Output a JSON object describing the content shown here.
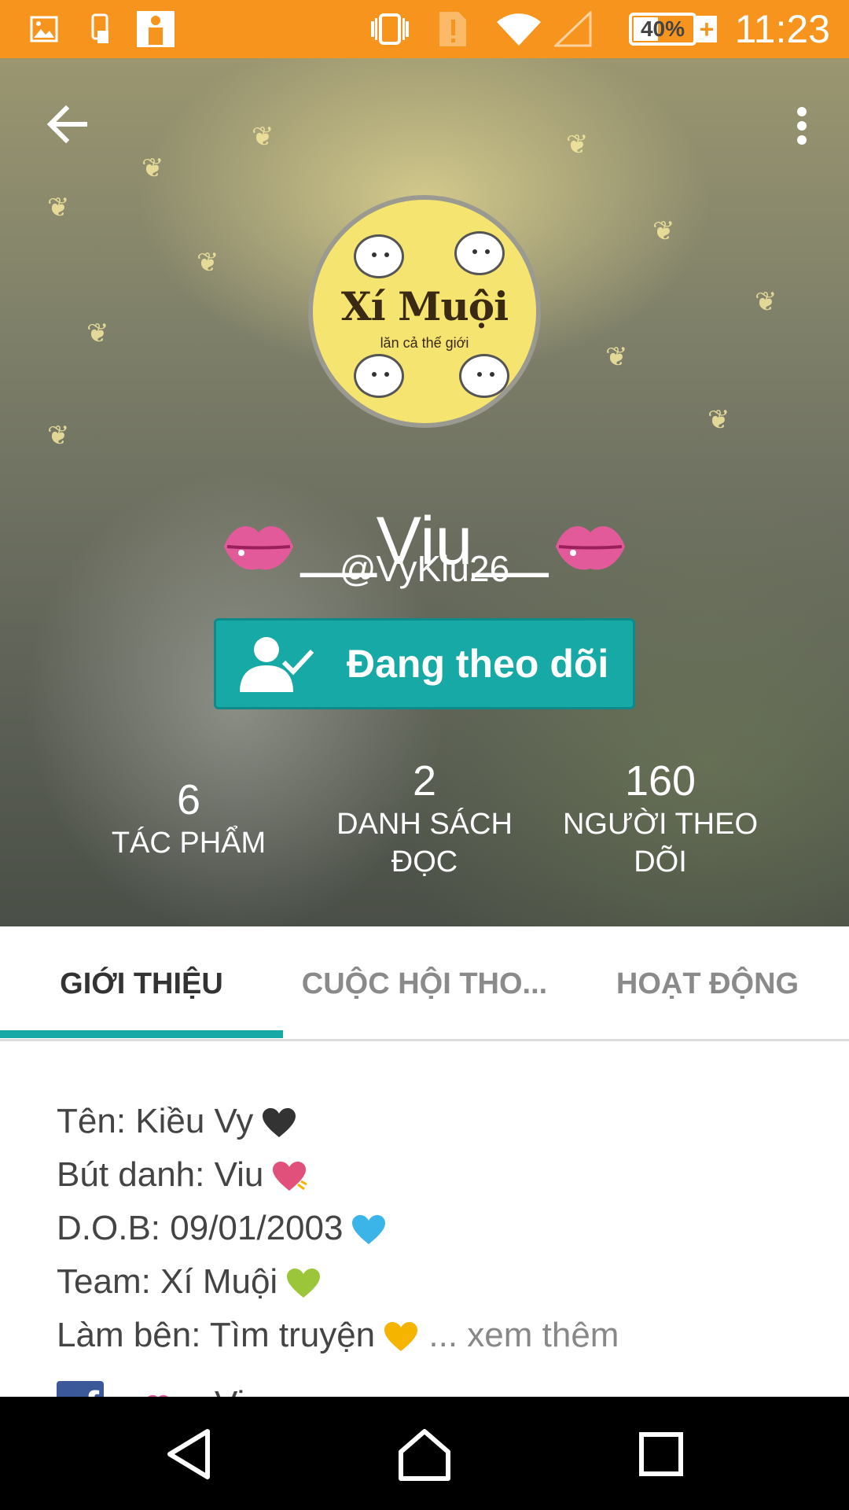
{
  "status_bar": {
    "time": "11:23",
    "battery": "40%",
    "battery_level": 0.4,
    "icons": [
      "image-icon",
      "phone-transfer-icon",
      "person-card-icon",
      "vibrate-icon",
      "alert-sim-icon",
      "wifi-icon",
      "signal-icon",
      "battery-icon",
      "charging-icon"
    ]
  },
  "header": {
    "back_icon": "arrow-left-icon",
    "more_icon": "more-vertical-icon"
  },
  "profile": {
    "avatar_title": "Xí Muội",
    "avatar_subtitle": "lăn cả thế giới",
    "display_name": "__Viu__",
    "handle": "@VyKiu26",
    "follow_button": "Đang theo dõi"
  },
  "stats": [
    {
      "value": "6",
      "label": "TÁC PHẨM"
    },
    {
      "value": "2",
      "label": "DANH SÁCH ĐỌC"
    },
    {
      "value": "160",
      "label": "NGƯỜI THEO DÕI"
    }
  ],
  "tabs": [
    {
      "label": "GIỚI THIỆU",
      "active": true
    },
    {
      "label": "CUỘC HỘI THO...",
      "active": false
    },
    {
      "label": "HOẠT ĐỘNG",
      "active": false
    }
  ],
  "about": {
    "lines": [
      {
        "text": "Tên: Kiều Vy",
        "heart_color": "#333333"
      },
      {
        "text": "Bút danh: Viu",
        "heart_color": "#e0507a"
      },
      {
        "text": "D.O.B: 09/01/2003",
        "heart_color": "#3bb5e8"
      },
      {
        "text": "Team: Xí Muội",
        "heart_color": "#9cc63a"
      },
      {
        "text": "Làm bên: Tìm truyện",
        "heart_color": "#f4b400"
      }
    ],
    "more": "... xem thêm",
    "fb_text": "__Viu__"
  },
  "colors": {
    "status_bar": "#f7941d",
    "accent": "#17a9a6",
    "active_tab_text": "#333333",
    "inactive_tab_text": "#8a8a8a"
  },
  "navigation": [
    "back-nav-icon",
    "home-nav-icon",
    "recents-nav-icon"
  ]
}
